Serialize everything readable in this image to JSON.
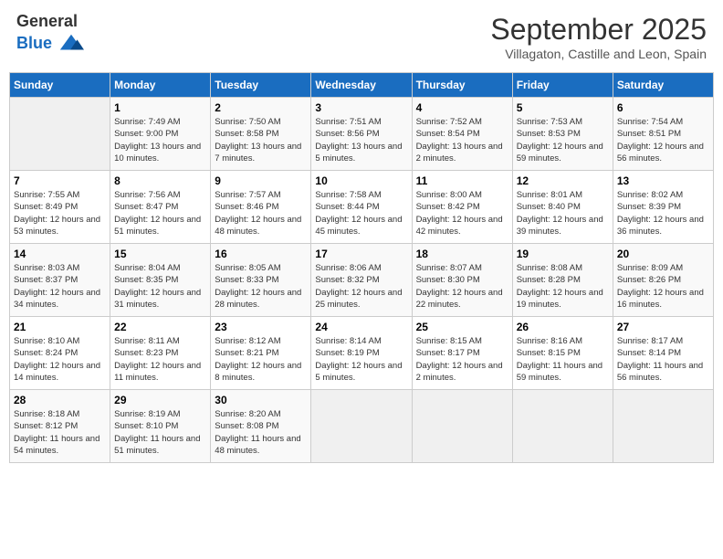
{
  "header": {
    "logo_general": "General",
    "logo_blue": "Blue",
    "month": "September 2025",
    "location": "Villagaton, Castille and Leon, Spain"
  },
  "days_of_week": [
    "Sunday",
    "Monday",
    "Tuesday",
    "Wednesday",
    "Thursday",
    "Friday",
    "Saturday"
  ],
  "weeks": [
    [
      {
        "num": "",
        "empty": true
      },
      {
        "num": "1",
        "sunrise": "Sunrise: 7:49 AM",
        "sunset": "Sunset: 9:00 PM",
        "daylight": "Daylight: 13 hours and 10 minutes."
      },
      {
        "num": "2",
        "sunrise": "Sunrise: 7:50 AM",
        "sunset": "Sunset: 8:58 PM",
        "daylight": "Daylight: 13 hours and 7 minutes."
      },
      {
        "num": "3",
        "sunrise": "Sunrise: 7:51 AM",
        "sunset": "Sunset: 8:56 PM",
        "daylight": "Daylight: 13 hours and 5 minutes."
      },
      {
        "num": "4",
        "sunrise": "Sunrise: 7:52 AM",
        "sunset": "Sunset: 8:54 PM",
        "daylight": "Daylight: 13 hours and 2 minutes."
      },
      {
        "num": "5",
        "sunrise": "Sunrise: 7:53 AM",
        "sunset": "Sunset: 8:53 PM",
        "daylight": "Daylight: 12 hours and 59 minutes."
      },
      {
        "num": "6",
        "sunrise": "Sunrise: 7:54 AM",
        "sunset": "Sunset: 8:51 PM",
        "daylight": "Daylight: 12 hours and 56 minutes."
      }
    ],
    [
      {
        "num": "7",
        "sunrise": "Sunrise: 7:55 AM",
        "sunset": "Sunset: 8:49 PM",
        "daylight": "Daylight: 12 hours and 53 minutes."
      },
      {
        "num": "8",
        "sunrise": "Sunrise: 7:56 AM",
        "sunset": "Sunset: 8:47 PM",
        "daylight": "Daylight: 12 hours and 51 minutes."
      },
      {
        "num": "9",
        "sunrise": "Sunrise: 7:57 AM",
        "sunset": "Sunset: 8:46 PM",
        "daylight": "Daylight: 12 hours and 48 minutes."
      },
      {
        "num": "10",
        "sunrise": "Sunrise: 7:58 AM",
        "sunset": "Sunset: 8:44 PM",
        "daylight": "Daylight: 12 hours and 45 minutes."
      },
      {
        "num": "11",
        "sunrise": "Sunrise: 8:00 AM",
        "sunset": "Sunset: 8:42 PM",
        "daylight": "Daylight: 12 hours and 42 minutes."
      },
      {
        "num": "12",
        "sunrise": "Sunrise: 8:01 AM",
        "sunset": "Sunset: 8:40 PM",
        "daylight": "Daylight: 12 hours and 39 minutes."
      },
      {
        "num": "13",
        "sunrise": "Sunrise: 8:02 AM",
        "sunset": "Sunset: 8:39 PM",
        "daylight": "Daylight: 12 hours and 36 minutes."
      }
    ],
    [
      {
        "num": "14",
        "sunrise": "Sunrise: 8:03 AM",
        "sunset": "Sunset: 8:37 PM",
        "daylight": "Daylight: 12 hours and 34 minutes."
      },
      {
        "num": "15",
        "sunrise": "Sunrise: 8:04 AM",
        "sunset": "Sunset: 8:35 PM",
        "daylight": "Daylight: 12 hours and 31 minutes."
      },
      {
        "num": "16",
        "sunrise": "Sunrise: 8:05 AM",
        "sunset": "Sunset: 8:33 PM",
        "daylight": "Daylight: 12 hours and 28 minutes."
      },
      {
        "num": "17",
        "sunrise": "Sunrise: 8:06 AM",
        "sunset": "Sunset: 8:32 PM",
        "daylight": "Daylight: 12 hours and 25 minutes."
      },
      {
        "num": "18",
        "sunrise": "Sunrise: 8:07 AM",
        "sunset": "Sunset: 8:30 PM",
        "daylight": "Daylight: 12 hours and 22 minutes."
      },
      {
        "num": "19",
        "sunrise": "Sunrise: 8:08 AM",
        "sunset": "Sunset: 8:28 PM",
        "daylight": "Daylight: 12 hours and 19 minutes."
      },
      {
        "num": "20",
        "sunrise": "Sunrise: 8:09 AM",
        "sunset": "Sunset: 8:26 PM",
        "daylight": "Daylight: 12 hours and 16 minutes."
      }
    ],
    [
      {
        "num": "21",
        "sunrise": "Sunrise: 8:10 AM",
        "sunset": "Sunset: 8:24 PM",
        "daylight": "Daylight: 12 hours and 14 minutes."
      },
      {
        "num": "22",
        "sunrise": "Sunrise: 8:11 AM",
        "sunset": "Sunset: 8:23 PM",
        "daylight": "Daylight: 12 hours and 11 minutes."
      },
      {
        "num": "23",
        "sunrise": "Sunrise: 8:12 AM",
        "sunset": "Sunset: 8:21 PM",
        "daylight": "Daylight: 12 hours and 8 minutes."
      },
      {
        "num": "24",
        "sunrise": "Sunrise: 8:14 AM",
        "sunset": "Sunset: 8:19 PM",
        "daylight": "Daylight: 12 hours and 5 minutes."
      },
      {
        "num": "25",
        "sunrise": "Sunrise: 8:15 AM",
        "sunset": "Sunset: 8:17 PM",
        "daylight": "Daylight: 12 hours and 2 minutes."
      },
      {
        "num": "26",
        "sunrise": "Sunrise: 8:16 AM",
        "sunset": "Sunset: 8:15 PM",
        "daylight": "Daylight: 11 hours and 59 minutes."
      },
      {
        "num": "27",
        "sunrise": "Sunrise: 8:17 AM",
        "sunset": "Sunset: 8:14 PM",
        "daylight": "Daylight: 11 hours and 56 minutes."
      }
    ],
    [
      {
        "num": "28",
        "sunrise": "Sunrise: 8:18 AM",
        "sunset": "Sunset: 8:12 PM",
        "daylight": "Daylight: 11 hours and 54 minutes."
      },
      {
        "num": "29",
        "sunrise": "Sunrise: 8:19 AM",
        "sunset": "Sunset: 8:10 PM",
        "daylight": "Daylight: 11 hours and 51 minutes."
      },
      {
        "num": "30",
        "sunrise": "Sunrise: 8:20 AM",
        "sunset": "Sunset: 8:08 PM",
        "daylight": "Daylight: 11 hours and 48 minutes."
      },
      {
        "num": "",
        "empty": true
      },
      {
        "num": "",
        "empty": true
      },
      {
        "num": "",
        "empty": true
      },
      {
        "num": "",
        "empty": true
      }
    ]
  ]
}
